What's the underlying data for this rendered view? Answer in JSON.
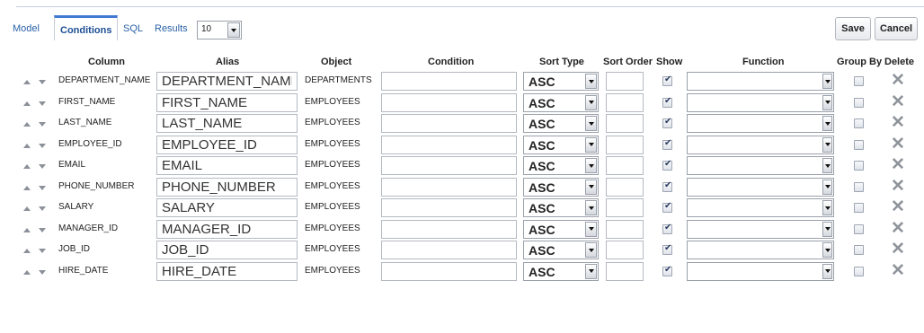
{
  "tabs": [
    {
      "label": "Model"
    },
    {
      "label": "Conditions"
    },
    {
      "label": "SQL"
    },
    {
      "label": "Results"
    }
  ],
  "rows_per_page": {
    "value": "10"
  },
  "actions": {
    "save_label": "Save",
    "cancel_label": "Cancel"
  },
  "headers": {
    "column": "Column",
    "alias": "Alias",
    "object": "Object",
    "condition": "Condition",
    "sort_type": "Sort Type",
    "sort_order": "Sort Order",
    "show": "Show",
    "function": "Function",
    "group_by": "Group By",
    "delete": "Delete"
  },
  "rows": [
    {
      "column": "DEPARTMENT_NAME",
      "alias": "DEPARTMENT_NAME",
      "object": "DEPARTMENTS",
      "condition": "",
      "sort_type": "ASC",
      "sort_order": "",
      "show": true,
      "function": "",
      "group_by": false
    },
    {
      "column": "FIRST_NAME",
      "alias": "FIRST_NAME",
      "object": "EMPLOYEES",
      "condition": "",
      "sort_type": "ASC",
      "sort_order": "",
      "show": true,
      "function": "",
      "group_by": false
    },
    {
      "column": "LAST_NAME",
      "alias": "LAST_NAME",
      "object": "EMPLOYEES",
      "condition": "",
      "sort_type": "ASC",
      "sort_order": "",
      "show": true,
      "function": "",
      "group_by": false
    },
    {
      "column": "EMPLOYEE_ID",
      "alias": "EMPLOYEE_ID",
      "object": "EMPLOYEES",
      "condition": "",
      "sort_type": "ASC",
      "sort_order": "",
      "show": true,
      "function": "",
      "group_by": false
    },
    {
      "column": "EMAIL",
      "alias": "EMAIL",
      "object": "EMPLOYEES",
      "condition": "",
      "sort_type": "ASC",
      "sort_order": "",
      "show": true,
      "function": "",
      "group_by": false
    },
    {
      "column": "PHONE_NUMBER",
      "alias": "PHONE_NUMBER",
      "object": "EMPLOYEES",
      "condition": "",
      "sort_type": "ASC",
      "sort_order": "",
      "show": true,
      "function": "",
      "group_by": false
    },
    {
      "column": "SALARY",
      "alias": "SALARY",
      "object": "EMPLOYEES",
      "condition": "",
      "sort_type": "ASC",
      "sort_order": "",
      "show": true,
      "function": "",
      "group_by": false
    },
    {
      "column": "MANAGER_ID",
      "alias": "MANAGER_ID",
      "object": "EMPLOYEES",
      "condition": "",
      "sort_type": "ASC",
      "sort_order": "",
      "show": true,
      "function": "",
      "group_by": false
    },
    {
      "column": "JOB_ID",
      "alias": "JOB_ID",
      "object": "EMPLOYEES",
      "condition": "",
      "sort_type": "ASC",
      "sort_order": "",
      "show": true,
      "function": "",
      "group_by": false
    },
    {
      "column": "HIRE_DATE",
      "alias": "HIRE_DATE",
      "object": "EMPLOYEES",
      "condition": "",
      "sort_type": "ASC",
      "sort_order": "",
      "show": true,
      "function": "",
      "group_by": false
    }
  ],
  "icons": {
    "move_up": "triangle-up-icon",
    "move_down": "triangle-down-icon",
    "dropdown": "triangle-down-icon",
    "show_checked": "checkmark-icon",
    "delete": "x-mark-icon"
  },
  "colors": {
    "tab_link": "#2a62a8",
    "tab_active_border": "#3f7ad0",
    "delete_icon": "#8f949b"
  }
}
